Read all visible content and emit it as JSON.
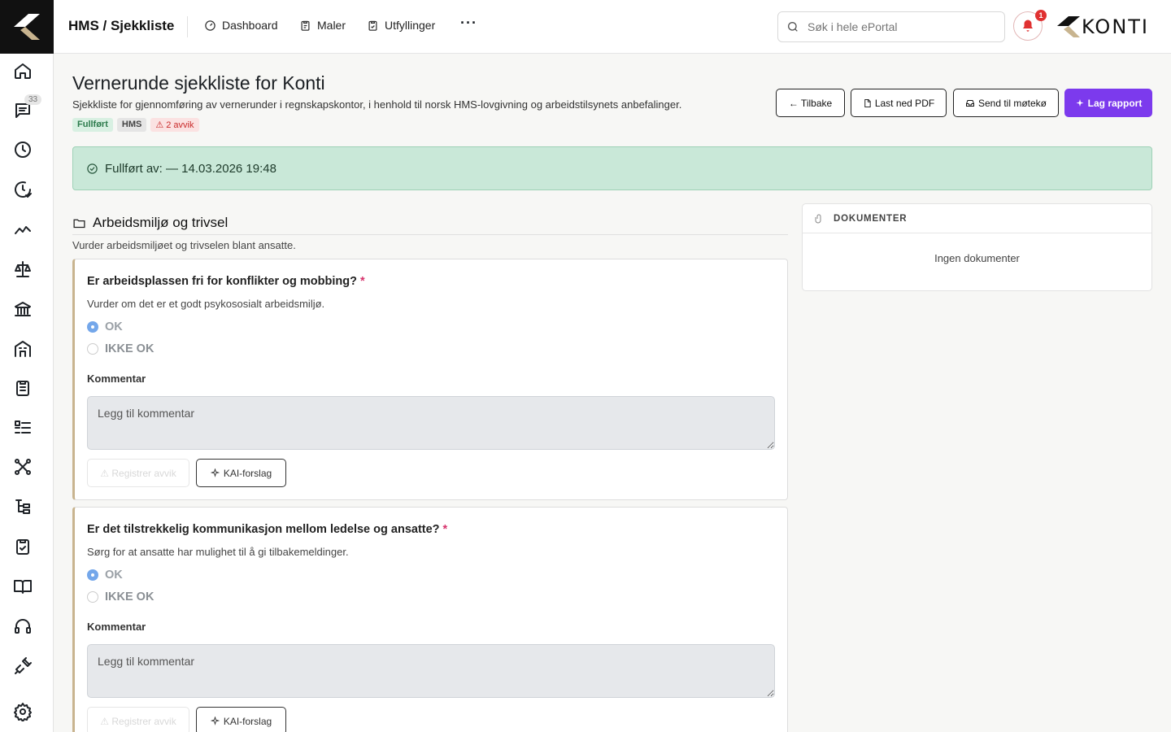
{
  "app": {
    "breadcrumb": "HMS / Sjekkliste",
    "brand_name": "KONTI"
  },
  "nav": [
    {
      "label": "Dashboard",
      "icon": "dashboard-icon"
    },
    {
      "label": "Maler",
      "icon": "clipboard-icon"
    },
    {
      "label": "Utfyllinger",
      "icon": "clipboard-check-icon"
    }
  ],
  "nav_more": "···",
  "search": {
    "placeholder": "Søk i hele ePortal",
    "value": ""
  },
  "notifications": {
    "count": "1"
  },
  "sidebar": {
    "badge": "33",
    "icons": [
      "home-icon",
      "chat-icon",
      "clock-icon",
      "clock-check-icon",
      "trend-icon",
      "scale-icon",
      "bank-icon",
      "building-icon",
      "clipboard-list-icon",
      "list-icon",
      "network-icon",
      "tree-icon",
      "clipboard-check-icon",
      "book-icon",
      "headset-icon",
      "plug-icon",
      "settings-icon"
    ]
  },
  "page": {
    "title": "Vernerunde sjekkliste for Konti",
    "subtitle": "Sjekkliste for gjennomføring av vernerunder i regnskapskontor, i henhold til norsk HMS-lovgivning og arbeidstilsynets anbefalinger.",
    "tags": {
      "status": "Fullført",
      "category": "HMS",
      "deviations": "⚠ 2 avvik"
    }
  },
  "actions": {
    "back": "← Tilbake",
    "pdf": "Last ned PDF",
    "meeting": "Send til møtekø",
    "report": "Lag rapport"
  },
  "banner": {
    "text": "Fullført av: — 14.03.2026 19:48"
  },
  "section": {
    "title": "Arbeidsmiljø og trivsel",
    "description": "Vurder arbeidsmiljøet og trivselen blant ansatte."
  },
  "questions": [
    {
      "title": "Er arbeidsplassen fri for konflikter og mobbing?",
      "required": "*",
      "description": "Vurder om det er et godt psykososialt arbeidsmiljø.",
      "option_ok": "OK",
      "option_not_ok": "IKKE OK",
      "selected": "OK",
      "comment_label": "Kommentar",
      "comment_placeholder": "Legg til kommentar",
      "register_button": "⚠ Registrer avvik",
      "kai_button": "KAI-forslag"
    },
    {
      "title": "Er det tilstrekkelig kommunikasjon mellom ledelse og ansatte?",
      "required": "*",
      "description": "Sørg for at ansatte har mulighet til å gi tilbakemeldinger.",
      "option_ok": "OK",
      "option_not_ok": "IKKE OK",
      "selected": "OK",
      "comment_label": "Kommentar",
      "comment_placeholder": "Legg til kommentar",
      "register_button": "⚠ Registrer avvik",
      "kai_button": "KAI-forslag"
    }
  ],
  "documents": {
    "title": "DOKUMENTER",
    "empty": "Ingen dokumenter"
  },
  "colors": {
    "accent": "#7c3aed",
    "success_bg": "#c9e8d8",
    "danger": "#e03131",
    "card_border": "#c8b48f"
  }
}
